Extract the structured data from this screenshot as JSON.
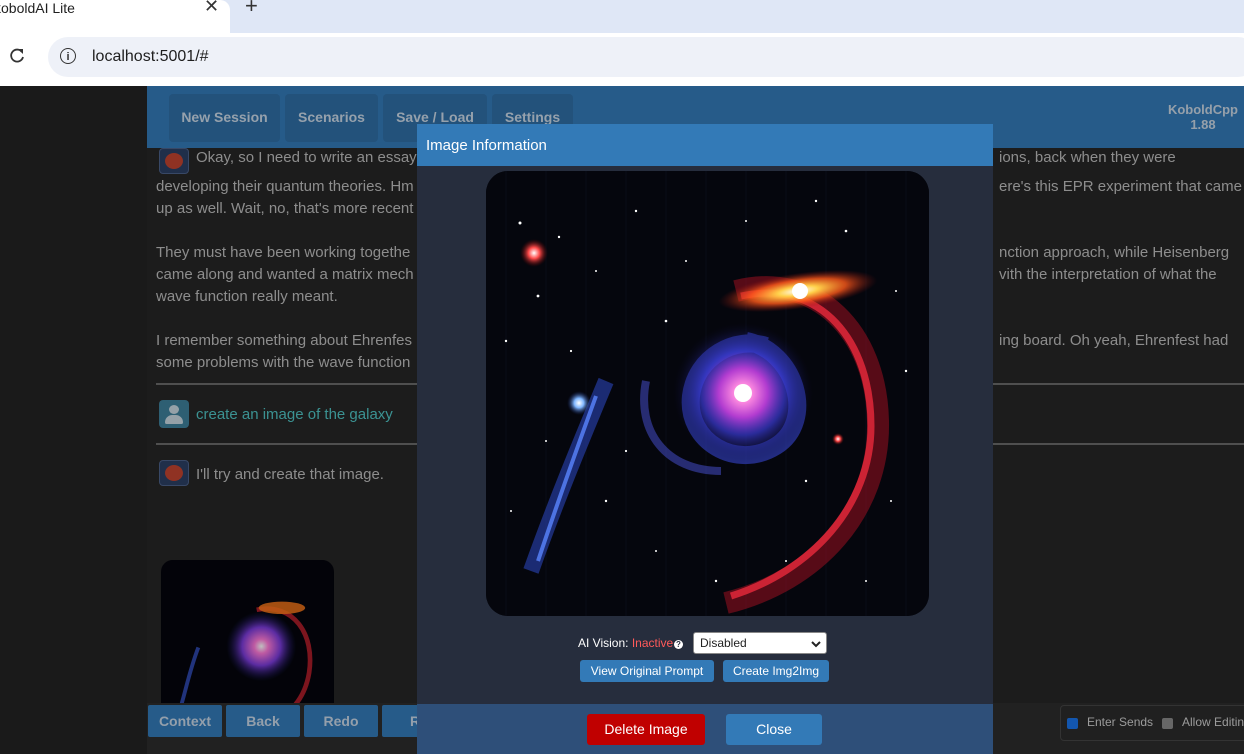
{
  "browser": {
    "tab_title": "koboldAI Lite",
    "close_glyph": "✕",
    "newtab_glyph": "+",
    "url": "localhost:5001/#",
    "info_glyph": "i"
  },
  "app": {
    "menu": [
      "New Session",
      "Scenarios",
      "Save / Load",
      "Settings"
    ],
    "brand": {
      "name": "KoboldCpp",
      "version": "1.88"
    },
    "story": {
      "ai_lines_1": [
        "Okay, so I need to write an essay",
        "developing their quantum theories. Hm",
        "up as well. Wait, no, that's more recent",
        "They must have been working togethe",
        "came along and wanted a matrix mech",
        "wave function really meant.",
        "I remember something about Ehrenfes",
        "some problems with the wave function"
      ],
      "ai_lines_right": [
        "ions, back when they were",
        "ere's this EPR experiment that came",
        "nction approach, while Heisenberg",
        "vith the interpretation of what the",
        "ing board. Oh yeah, Ehrenfest had"
      ],
      "user_message": "create an image of the galaxy",
      "ai_reply": "I'll try and create that image."
    },
    "bottom_buttons": [
      "Context",
      "Back",
      "Redo",
      "Re"
    ],
    "options": {
      "enter_sends": "Enter Sends",
      "allow_editing": "Allow Editing"
    }
  },
  "modal": {
    "title": "Image Information",
    "vision_label": "AI Vision: ",
    "vision_status": "Inactive",
    "help_glyph": "?",
    "vision_select": "Disabled",
    "view_prompt_button": "View Original Prompt",
    "img2img_button": "Create Img2Img",
    "delete_button": "Delete Image",
    "close_button": "Close"
  },
  "colors": {
    "accent": "#337ab7",
    "danger": "#c00000",
    "inactive": "#ff5a5a",
    "user_text": "#4fc3c3"
  }
}
